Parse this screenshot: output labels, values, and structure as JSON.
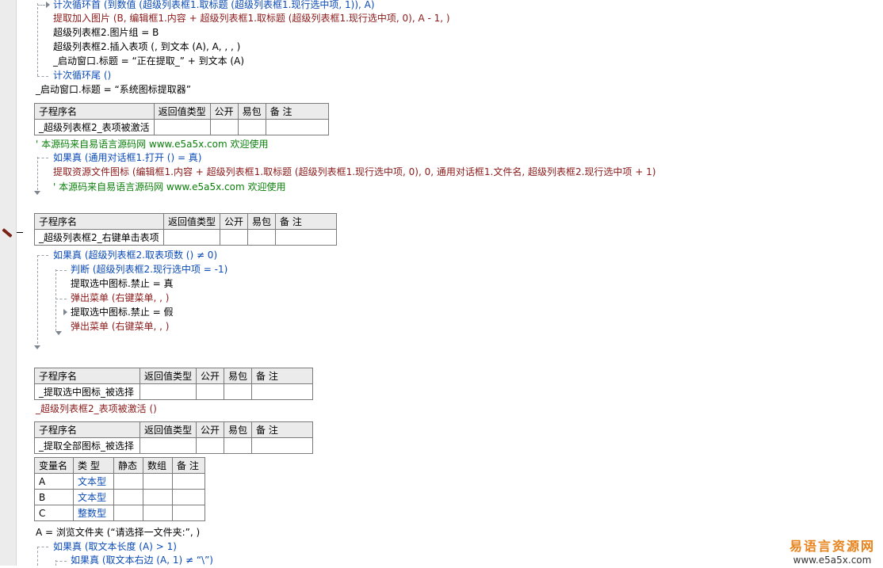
{
  "code": {
    "loop_head": "计次循环首 (到数值 (超级列表框1.取标题 (超级列表框1.现行选中项, 1)), A)",
    "extract_icon": "提取加入图片 (B, 编辑框1.内容 + 超级列表框1.取标题 (超级列表框1.现行选中项, 0), A - 1, )",
    "imagegroup": "超级列表框2.图片组 = B",
    "insert_item": "超级列表框2.插入表项 (, 到文本 (A), A, , , )",
    "title_extracting": "_启动窗口.标题 = “正在提取_” + 到文本 (A)",
    "loop_tail": "计次循环尾 ()",
    "title_final": "_启动窗口.标题 = “系统图标提取器”",
    "comment1": "' 本源码来自易语言源码网 www.e5a5x.com  欢迎使用",
    "if_open": "如果真 (通用对话框1.打开 () = 真)",
    "extract_res": "提取资源文件图标 (编辑框1.内容 + 超级列表框1.取标题 (超级列表框1.现行选中项, 0), 0, 通用对话框1.文件名, 超级列表框2.现行选中项 + 1)",
    "comment2": "' 本源码来自易语言源码网 www.e5a5x.com  欢迎使用",
    "if_count": "如果真 (超级列表框2.取表项数 () ≠ 0)",
    "judge": "判断 (超级列表框2.现行选中项 = -1)",
    "disable_true": "提取选中图标.禁止 = 真",
    "popup1": "弹出菜单 (右键菜单, , )",
    "disable_false": "提取选中图标.禁止 = 假",
    "popup2": "弹出菜单 (右键菜单, , )",
    "call_activated": "_超级列表框2_表项被激活 ()",
    "browse": "A = 浏览文件夹 (“请选择一文件夹:”, )",
    "if_len": "如果真 (取文本长度 (A) > 1)",
    "if_right": "如果真 (取文本右边 (A, 1) ≠ “\\”)"
  },
  "sub_header": {
    "name": "子程序名",
    "ret": "返回值类型",
    "public": "公开",
    "easy": "易包",
    "note": "备 注"
  },
  "subs": {
    "s1": "_超级列表框2_表项被激活",
    "s2": "_超级列表框2_右键单击表项",
    "s3": "_提取选中图标_被选择",
    "s4": "_提取全部图标_被选择"
  },
  "var_header": {
    "name": "变量名",
    "type": "类 型",
    "static": "静态",
    "array": "数组",
    "note": "备 注"
  },
  "vars": [
    {
      "name": "A",
      "type": "文本型"
    },
    {
      "name": "B",
      "type": "文本型"
    },
    {
      "name": "C",
      "type": "整数型"
    }
  ],
  "watermark": {
    "title": "易语言资源网",
    "url": "www.e5a5x.com"
  }
}
